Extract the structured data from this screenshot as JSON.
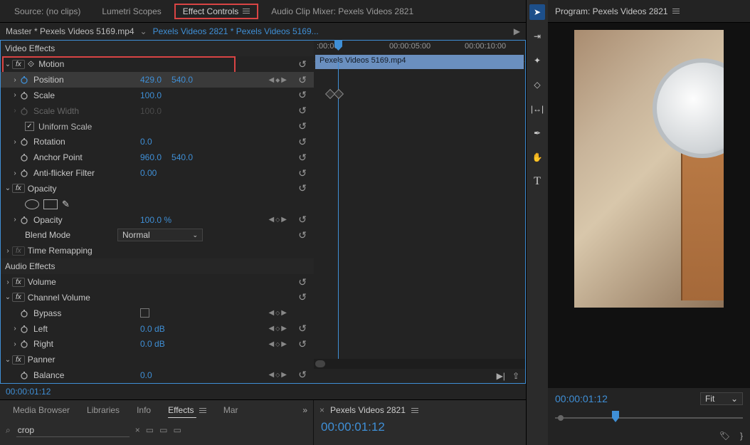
{
  "topTabs": {
    "source": "Source: (no clips)",
    "lumetri": "Lumetri Scopes",
    "effectControls": "Effect Controls",
    "audioMixer": "Audio Clip Mixer: Pexels Videos 2821"
  },
  "breadcrumb": {
    "master": "Master * Pexels Videos 5169.mp4",
    "sequence": "Pexels Videos 2821 * Pexels Videos 5169..."
  },
  "sections": {
    "videoEffects": "Video Effects",
    "audioEffects": "Audio Effects"
  },
  "effects": {
    "motion": {
      "name": "Motion",
      "position": {
        "label": "Position",
        "x": "429.0",
        "y": "540.0"
      },
      "scale": {
        "label": "Scale",
        "value": "100.0"
      },
      "scaleWidth": {
        "label": "Scale Width",
        "value": "100.0"
      },
      "uniform": "Uniform Scale",
      "rotation": {
        "label": "Rotation",
        "value": "0.0"
      },
      "anchor": {
        "label": "Anchor Point",
        "x": "960.0",
        "y": "540.0"
      },
      "antiflicker": {
        "label": "Anti-flicker Filter",
        "value": "0.00"
      }
    },
    "opacity": {
      "name": "Opacity",
      "opacityProp": {
        "label": "Opacity",
        "value": "100.0 %"
      },
      "blendMode": {
        "label": "Blend Mode",
        "value": "Normal"
      }
    },
    "timeRemap": "Time Remapping",
    "volume": "Volume",
    "channelVolume": {
      "name": "Channel Volume",
      "bypass": "Bypass",
      "left": {
        "label": "Left",
        "value": "0.0 dB"
      },
      "right": {
        "label": "Right",
        "value": "0.0 dB"
      }
    },
    "panner": {
      "name": "Panner",
      "balance": {
        "label": "Balance",
        "value": "0.0"
      }
    }
  },
  "clipName": "Pexels Videos 5169.mp4",
  "ruler": {
    "t0": ":00:00",
    "t1": "00:00:05:00",
    "t2": "00:00:10:00"
  },
  "statusTc": "00:00:01:12",
  "bottomTabs": {
    "mediaBrowser": "Media Browser",
    "libraries": "Libraries",
    "info": "Info",
    "effects": "Effects",
    "markers": "Mar"
  },
  "searchValue": "crop",
  "timelinePanel": {
    "tabLabel": "Pexels Videos 2821",
    "tc": "00:00:01:12"
  },
  "program": {
    "title": "Program: Pexels Videos 2821",
    "tc": "00:00:01:12",
    "fit": "Fit"
  }
}
